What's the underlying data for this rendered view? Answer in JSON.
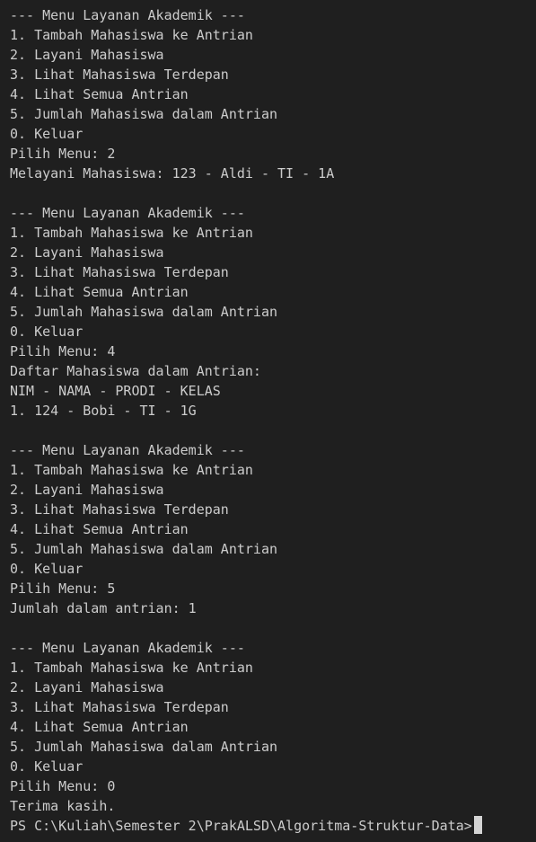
{
  "terminal": {
    "background_color": "#1f1f1f",
    "text_color": "#cccccc",
    "cursor_color": "#d4d4d4",
    "lines": [
      "--- Menu Layanan Akademik ---",
      "1. Tambah Mahasiswa ke Antrian",
      "2. Layani Mahasiswa",
      "3. Lihat Mahasiswa Terdepan",
      "4. Lihat Semua Antrian",
      "5. Jumlah Mahasiswa dalam Antrian",
      "0. Keluar",
      "Pilih Menu: 2",
      "Melayani Mahasiswa: 123 - Aldi - TI - 1A",
      "",
      "--- Menu Layanan Akademik ---",
      "1. Tambah Mahasiswa ke Antrian",
      "2. Layani Mahasiswa",
      "3. Lihat Mahasiswa Terdepan",
      "4. Lihat Semua Antrian",
      "5. Jumlah Mahasiswa dalam Antrian",
      "0. Keluar",
      "Pilih Menu: 4",
      "Daftar Mahasiswa dalam Antrian:",
      "NIM - NAMA - PRODI - KELAS",
      "1. 124 - Bobi - TI - 1G",
      "",
      "--- Menu Layanan Akademik ---",
      "1. Tambah Mahasiswa ke Antrian",
      "2. Layani Mahasiswa",
      "3. Lihat Mahasiswa Terdepan",
      "4. Lihat Semua Antrian",
      "5. Jumlah Mahasiswa dalam Antrian",
      "0. Keluar",
      "Pilih Menu: 5",
      "Jumlah dalam antrian: 1",
      "",
      "--- Menu Layanan Akademik ---",
      "1. Tambah Mahasiswa ke Antrian",
      "2. Layani Mahasiswa",
      "3. Lihat Mahasiswa Terdepan",
      "4. Lihat Semua Antrian",
      "5. Jumlah Mahasiswa dalam Antrian",
      "0. Keluar",
      "Pilih Menu: 0",
      "Terima kasih."
    ],
    "prompt": "PS C:\\Kuliah\\Semester 2\\PrakALSD\\Algoritma-Struktur-Data>"
  }
}
